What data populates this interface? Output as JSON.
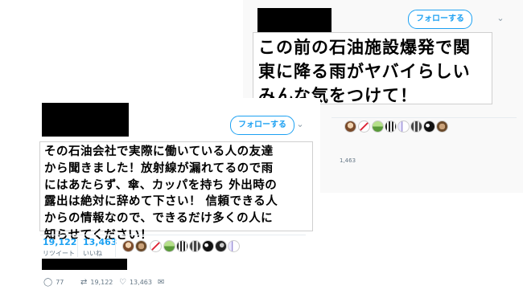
{
  "right_tweet": {
    "follow_label": "フォローする",
    "text_lines": [
      "この前の石油施設爆発で関",
      "東に降る雨がヤバイらしい",
      "みんな気をつけて！"
    ],
    "footer_count": "1,463"
  },
  "left_tweet": {
    "follow_label": "フォローする",
    "text_lines": [
      "その石油会社で実際に働いている人の友達",
      "から聞きました！放射線が漏れてるので雨",
      "にはあたらず、傘、カッパを持ち 外出時の",
      "露出は絶対に辞めて下さい！ 信頼できる人",
      "からの情報なので、できるだけ多くの人に",
      "知らせてください！"
    ],
    "retweets_count": "19,122",
    "retweets_label": "リツイート",
    "likes_count": "13,463",
    "likes_label": "いいね",
    "actions": {
      "reply_count": "77",
      "retweet_count": "19,122",
      "like_count": "13,463"
    }
  },
  "icons": {
    "chevron": "chevron-down-icon",
    "reply": "reply-icon",
    "retweet": "retweet-icon",
    "like": "heart-icon",
    "dm": "envelope-icon"
  },
  "colors": {
    "accent": "#1da1f2",
    "muted": "#657786",
    "redaction": "#000000"
  }
}
